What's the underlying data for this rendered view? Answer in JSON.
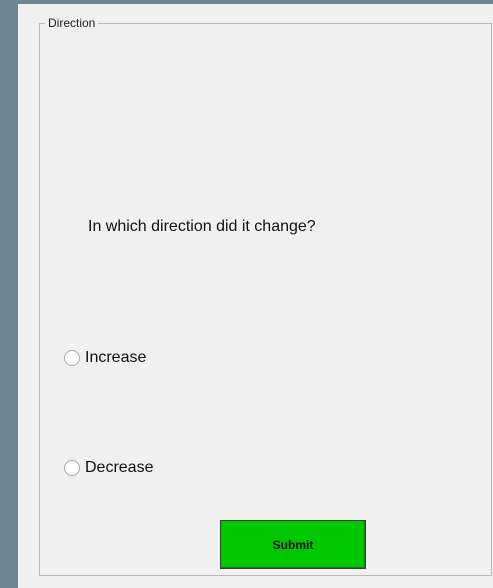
{
  "group": {
    "title": "Direction"
  },
  "question": {
    "text": "In which direction did it change?"
  },
  "options": [
    {
      "label": "Increase",
      "selected": false
    },
    {
      "label": "Decrease",
      "selected": false
    }
  ],
  "submit": {
    "label": "Submit"
  },
  "colors": {
    "submit_bg": "#00c800",
    "background": "#6f8591",
    "panel": "#f0f0f0"
  }
}
